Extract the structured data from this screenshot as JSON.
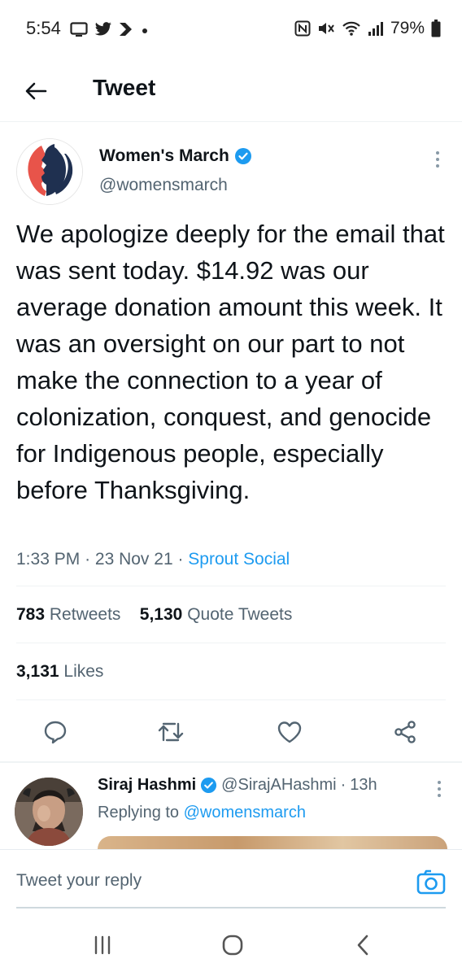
{
  "status_bar": {
    "time": "5:54",
    "battery": "79%",
    "left_icons": [
      "cast-icon",
      "twitter-bird-icon",
      "arrow-app-icon",
      "dot-icon"
    ],
    "right_icons": [
      "nfc-icon",
      "mute-icon",
      "wifi-icon",
      "signal-icon",
      "battery-icon"
    ]
  },
  "header": {
    "title": "Tweet"
  },
  "tweet": {
    "author_name": "Women's March",
    "author_handle": "@womensmarch",
    "verified": true,
    "text": "We apologize deeply for the email that was sent today. $14.92 was our average donation amount this week. It was an oversight on our part to not make the connection to a year of colonization, conquest, and genocide for Indigenous people, especially before Thanksgiving.",
    "time": "1:33 PM",
    "date": "23 Nov 21",
    "source": "Sprout Social",
    "retweets_count": "783",
    "retweets_label": "Retweets",
    "quote_count": "5,130",
    "quote_label": "Quote Tweets",
    "likes_count": "3,131",
    "likes_label": "Likes"
  },
  "reply": {
    "author_name": "Siraj Hashmi",
    "author_handle": "@SirajAHashmi",
    "time_ago": "13h",
    "replying_prefix": "Replying to",
    "replying_handle": "@womensmarch"
  },
  "composer": {
    "placeholder": "Tweet your reply"
  },
  "colors": {
    "twitter_blue": "#1d9bf0",
    "text_primary": "#0f1419",
    "text_secondary": "#536471",
    "logo_red": "#e8544a",
    "logo_navy": "#1f3050"
  }
}
